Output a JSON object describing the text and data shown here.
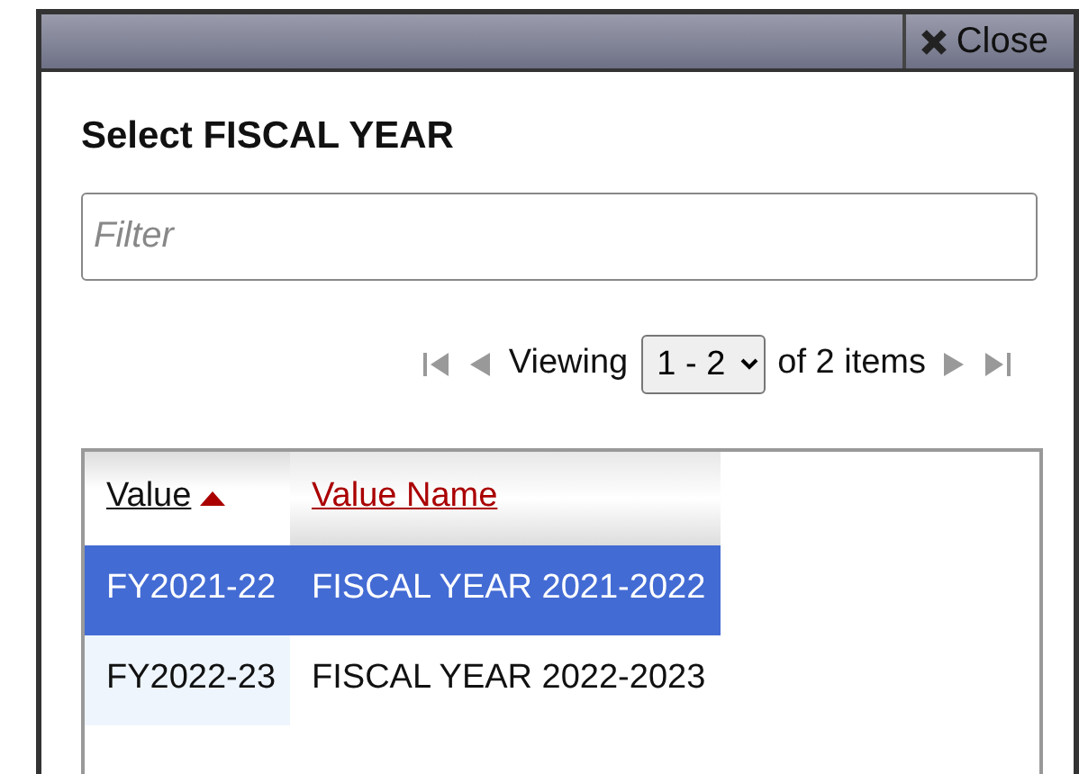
{
  "close_button": {
    "label": "Close"
  },
  "heading": "Select FISCAL YEAR",
  "filter": {
    "placeholder": "Filter"
  },
  "pager": {
    "prefix": "Viewing",
    "range": "1 - 2",
    "suffix": "of 2 items",
    "first_disabled": true,
    "prev_disabled": true,
    "next_disabled": true,
    "last_disabled": true
  },
  "table": {
    "columns": [
      {
        "label": "Value",
        "sorted": true
      },
      {
        "label": "Value Name",
        "sorted": false
      }
    ],
    "rows": [
      {
        "cells": [
          "FY2021-22",
          "FISCAL YEAR 2021-2022"
        ],
        "selected": true
      },
      {
        "cells": [
          "FY2022-23",
          "FISCAL YEAR 2022-2023"
        ],
        "selected": false
      }
    ]
  }
}
